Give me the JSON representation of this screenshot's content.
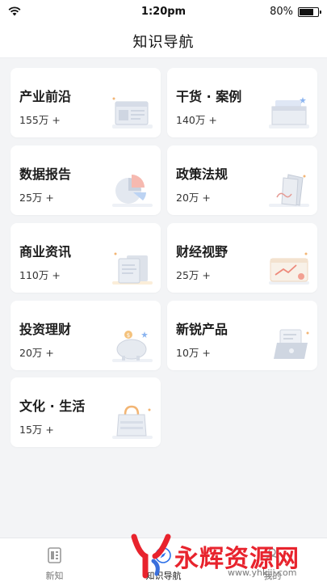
{
  "status": {
    "time": "1:20pm",
    "battery": "80%",
    "battery_level": 0.8
  },
  "nav": {
    "title": "知识导航"
  },
  "cards": [
    {
      "name": "产业前沿",
      "count": "155万 +",
      "icon": "newspaper-icon"
    },
    {
      "name": "干货 · 案例",
      "count": "140万 +",
      "icon": "case-folder-icon"
    },
    {
      "name": "数据报告",
      "count": "25万 +",
      "icon": "pie-chart-icon"
    },
    {
      "name": "政策法规",
      "count": "20万 +",
      "icon": "policy-document-icon"
    },
    {
      "name": "商业资讯",
      "count": "110万 +",
      "icon": "document-stack-icon"
    },
    {
      "name": "财经视野",
      "count": "25万 +",
      "icon": "trend-chart-icon"
    },
    {
      "name": "投资理财",
      "count": "20万 +",
      "icon": "piggy-bank-icon"
    },
    {
      "name": "新锐产品",
      "count": "10万 +",
      "icon": "laptop-icon"
    },
    {
      "name": "文化 · 生活",
      "count": "15万 +",
      "icon": "shopping-bag-icon"
    }
  ],
  "tabs": [
    {
      "label": "新知",
      "icon": "news-icon",
      "active": false
    },
    {
      "label": "知识导航",
      "icon": "compass-icon",
      "active": true
    },
    {
      "label": "我的",
      "icon": "user-icon",
      "active": false
    }
  ],
  "watermark": {
    "text": "永辉资源网",
    "url": "www.yhkjjj.com"
  },
  "colors": {
    "accent": "#e8232d",
    "card_bg": "#ffffff",
    "page_bg": "#f3f4f6"
  }
}
